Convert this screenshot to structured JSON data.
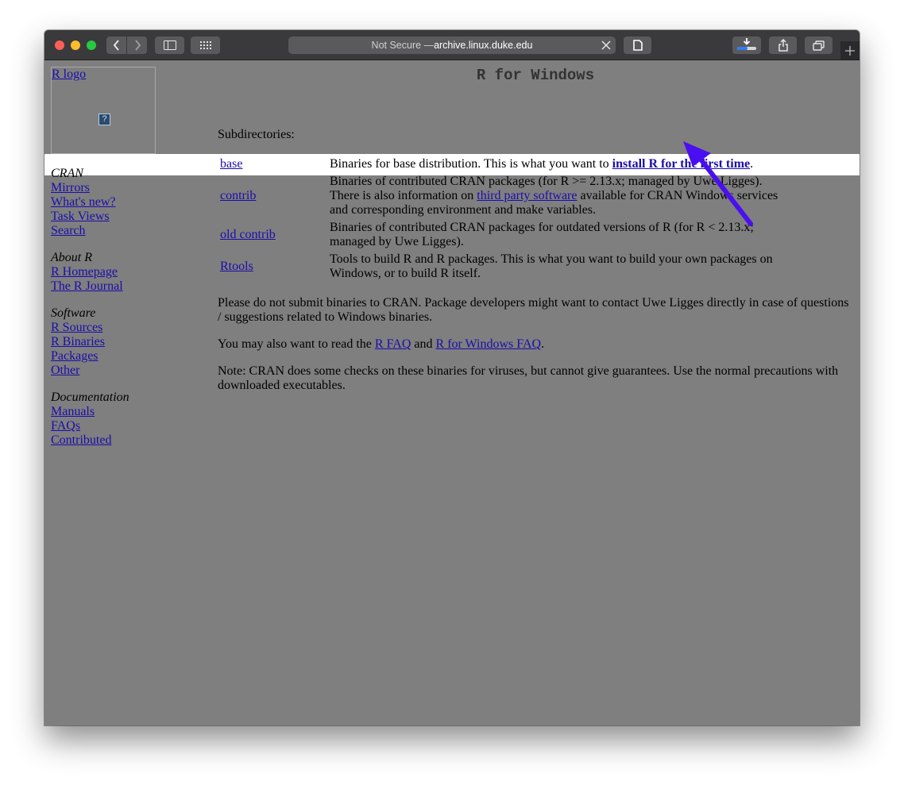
{
  "browser": {
    "address_prefix": "Not Secure — ",
    "address_host": "archive.linux.duke.edu"
  },
  "sidebar": {
    "logo_alt": "R logo",
    "broken_image": "?",
    "groups": [
      {
        "heading": "CRAN",
        "links": [
          "Mirrors",
          "What's new?",
          "Task Views",
          "Search"
        ]
      },
      {
        "heading": "About R",
        "links": [
          "R Homepage",
          "The R Journal"
        ]
      },
      {
        "heading": "Software",
        "links": [
          "R Sources",
          "R Binaries",
          "Packages",
          "Other"
        ]
      },
      {
        "heading": "Documentation",
        "links": [
          "Manuals",
          "FAQs",
          "Contributed"
        ]
      }
    ]
  },
  "main": {
    "title": "R for Windows",
    "subdirs_label": "Subdirectories:",
    "rows": {
      "base": {
        "link": "base",
        "desc_before": "Binaries for base distribution. This is what you want to ",
        "desc_link": "install R for the first time",
        "desc_after": "."
      },
      "contrib": {
        "link": "contrib",
        "line1": "Binaries of contributed CRAN packages (for R >= 2.13.x; managed by Uwe Ligges).",
        "line2_before": "There is also information on ",
        "line2_link": "third party software",
        "line2_after": " available for CRAN Windows services",
        "line3": "and corresponding environment and make variables."
      },
      "old_contrib": {
        "link": "old contrib",
        "line1": "Binaries of contributed CRAN packages for outdated versions of R (for R < 2.13.x;",
        "line2": "managed by Uwe Ligges)."
      },
      "rtools": {
        "link": "Rtools",
        "line1": "Tools to build R and R packages. This is what you want to build your own packages on",
        "line2": "Windows, or to build R itself."
      }
    },
    "para1_line1": "Please do not submit binaries to CRAN. Package developers might want to contact Uwe Ligges directly in case of questions",
    "para1_line2": "/ suggestions related to Windows binaries.",
    "para2_before": "You may also want to read the ",
    "para2_link1": "R FAQ",
    "para2_mid": " and ",
    "para2_link2": "R for Windows FAQ",
    "para2_after": ".",
    "para3_line1": "Note: CRAN does some checks on these binaries for viruses, but cannot give guarantees. Use the normal precautions with",
    "para3_line2": "downloaded executables."
  },
  "colors": {
    "annotation_arrow": "#4a0ff0",
    "page_background": "#7f7f7f",
    "highlight_row": "#ffffff"
  }
}
